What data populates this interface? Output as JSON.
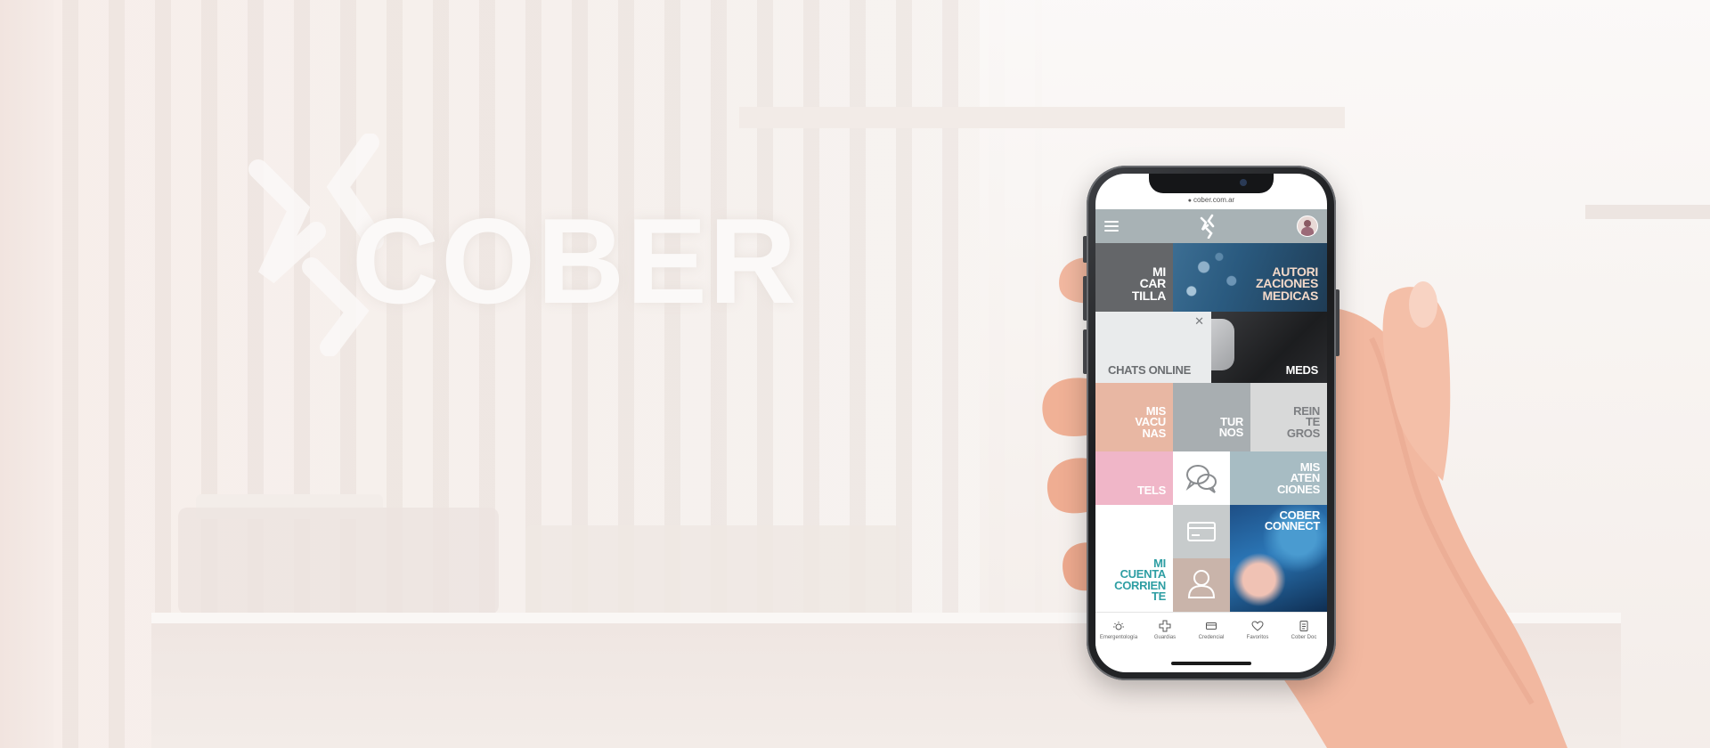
{
  "background": {
    "brand_text": "COBER",
    "colors": {
      "base": "#f6f1ee",
      "slats": "#e1d6d0"
    }
  },
  "phone": {
    "url": "cober.com.ar",
    "header": {
      "menu_icon": "hamburger-icon",
      "logo_icon": "cober-logo-icon",
      "avatar_icon": "user-avatar-icon",
      "color": "#a8b2b5"
    },
    "tiles": {
      "micartilla": {
        "lines": [
          "MI",
          "CAR",
          "TILLA"
        ],
        "color": "#646669",
        "text_color": "#ffffff"
      },
      "autorizaciones": {
        "lines": [
          "AUTORI",
          "ZACIONES",
          "MEDICAS"
        ],
        "text_color": "#f3d9c9"
      },
      "chats": {
        "label": "CHATS ONLINE",
        "close_icon": "close-icon",
        "color": "#e9ebec",
        "text_color": "#6b6e71"
      },
      "meds": {
        "label": "MEDS",
        "text_color": "#ffffff"
      },
      "vacunas": {
        "lines": [
          "MIS",
          "VACU",
          "NAS"
        ],
        "color": "#e8b7a3",
        "text_color": "#ffffff"
      },
      "turnos": {
        "lines": [
          "TUR",
          "NOS"
        ],
        "color": "#a8aeb1",
        "text_color": "#ffffff"
      },
      "reintegros": {
        "lines": [
          "REIN",
          "TE",
          "GROS"
        ],
        "color": "#d8d9d9",
        "text_color": "#7d7f82"
      },
      "tels": {
        "label": "TELS",
        "color": "#f0b6c8",
        "text_color": "#ffffff"
      },
      "chat_icon": {
        "icon": "chat-bubbles-icon"
      },
      "atenciones": {
        "lines": [
          "MIS",
          "ATEN",
          "CIONES"
        ],
        "color": "#a7bcc3",
        "text_color": "#ffffff"
      },
      "cuenta": {
        "lines": [
          "MI",
          "CUENTA",
          "CORRIEN",
          "TE"
        ],
        "text_color": "#2e9ea3"
      },
      "card_icon": {
        "icon": "credit-card-icon"
      },
      "user_icon": {
        "icon": "user-icon"
      },
      "connect": {
        "lines": [
          "COBER",
          "CONNECT"
        ],
        "text_color": "#ffffff"
      }
    },
    "bottom_nav": [
      {
        "icon": "sun-icon",
        "label": "Emergentología"
      },
      {
        "icon": "plus-icon",
        "label": "Guardias"
      },
      {
        "icon": "credential-card-icon",
        "label": "Credencial"
      },
      {
        "icon": "heart-icon",
        "label": "Favoritos"
      },
      {
        "icon": "document-icon",
        "label": "Cober Doc"
      }
    ]
  }
}
